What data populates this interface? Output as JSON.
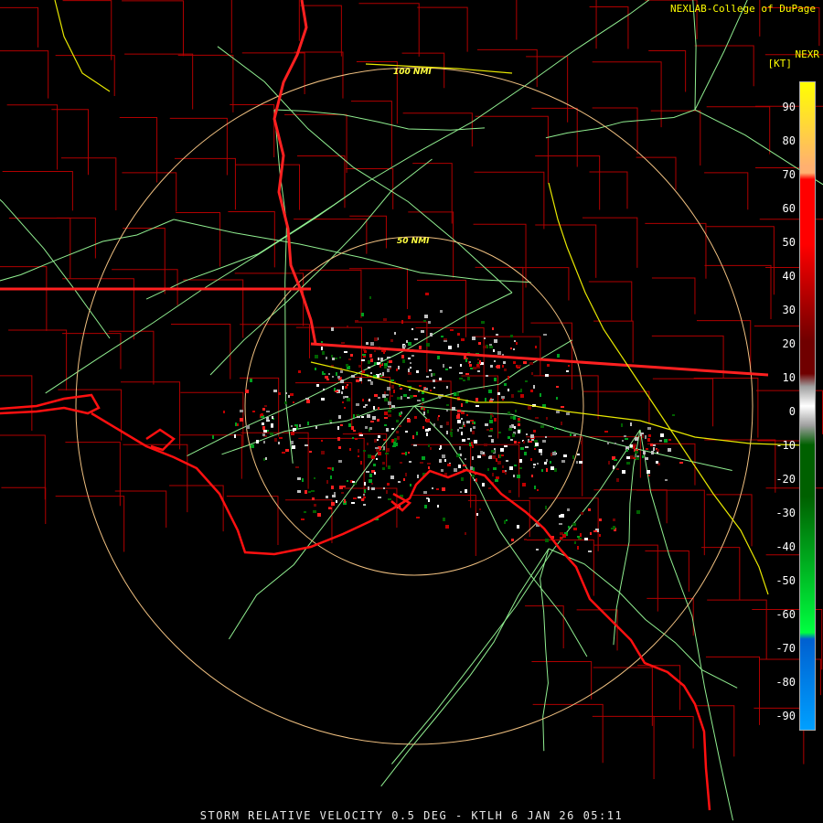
{
  "header": {
    "credit": "NEXLAB-College of DuPage",
    "product": "NEXR",
    "unit": "[KT]"
  },
  "rings": [
    {
      "label": "100 NMI"
    },
    {
      "label": "50 NMI"
    }
  ],
  "legend": {
    "ticks": [
      "90",
      "80",
      "70",
      "60",
      "50",
      "40",
      "30",
      "20",
      "10",
      "0",
      "-10",
      "-20",
      "-30",
      "-40",
      "-50",
      "-60",
      "-70",
      "-80",
      "-90"
    ],
    "colors": {
      "yellow": "#ffff00",
      "orange": "#ffb070",
      "red": "#ff0000",
      "dark_red": "#700000",
      "gray": "#a0a0a0",
      "white": "#ffffff",
      "dark_green": "#006000",
      "green": "#00ff40",
      "blue": "#0060d0",
      "light_blue": "#00a0ff"
    }
  },
  "footer": {
    "text": "STORM RELATIVE VELOCITY 0.5 DEG - KTLH 6 JAN 26 05:11"
  },
  "map_colors": {
    "county_lines": "#b00000",
    "state_lines": "#ff2020",
    "coastline": "#ff1010",
    "highways": "#90ee90",
    "interstates": "#e8e800",
    "range_rings": "#f0c080"
  }
}
